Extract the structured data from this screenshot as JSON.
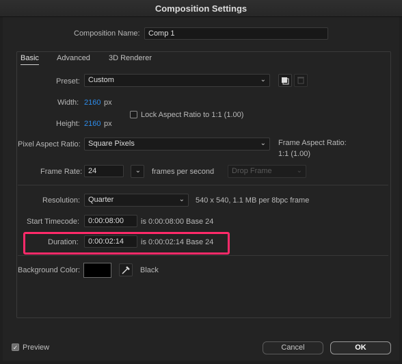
{
  "window": {
    "title": "Composition Settings"
  },
  "composition_name": {
    "label": "Composition Name:",
    "value": "Comp 1"
  },
  "tabs": [
    {
      "label": "Basic",
      "active": true
    },
    {
      "label": "Advanced",
      "active": false
    },
    {
      "label": "3D Renderer",
      "active": false
    }
  ],
  "preset": {
    "label": "Preset:",
    "value": "Custom"
  },
  "width": {
    "label": "Width:",
    "value": "2160",
    "unit": "px"
  },
  "height": {
    "label": "Height:",
    "value": "2160",
    "unit": "px"
  },
  "lock_aspect": {
    "label": "Lock Aspect Ratio to 1:1 (1.00)",
    "checked": false
  },
  "pixel_aspect": {
    "label": "Pixel Aspect Ratio:",
    "value": "Square Pixels"
  },
  "frame_aspect": {
    "label": "Frame Aspect Ratio:",
    "value": "1:1 (1.00)"
  },
  "frame_rate": {
    "label": "Frame Rate:",
    "value": "24",
    "unit": "frames per second",
    "drop_frame": "Drop Frame"
  },
  "resolution": {
    "label": "Resolution:",
    "value": "Quarter",
    "info": "540 x 540, 1.1 MB per 8bpc frame"
  },
  "start_timecode": {
    "label": "Start Timecode:",
    "value": "0:00:08:00",
    "info": "is 0:00:08:00  Base 24"
  },
  "duration": {
    "label": "Duration:",
    "value": "0:00:02:14",
    "info": "is 0:00:02:14  Base 24"
  },
  "background_color": {
    "label": "Background Color:",
    "name": "Black",
    "color": "#000000"
  },
  "preview": {
    "label": "Preview",
    "checked": true
  },
  "buttons": {
    "cancel": "Cancel",
    "ok": "OK"
  },
  "colors": {
    "accent_highlight": "#ff2a6a",
    "value_blue": "#2d8ceb"
  }
}
